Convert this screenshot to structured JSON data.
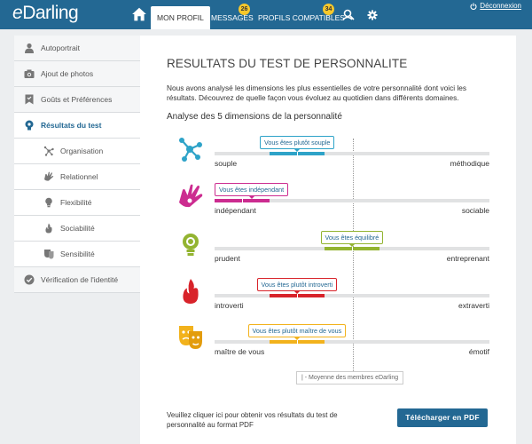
{
  "header": {
    "logo": "Darling",
    "logo_e": "e",
    "tabs": [
      {
        "label": "MON PROFIL"
      },
      {
        "label": "MESSAGES",
        "badge": "26"
      },
      {
        "label": "PROFILS COMPATIBLES",
        "badge": "34"
      }
    ],
    "logout": "Déconnexion"
  },
  "sidebar": {
    "items": [
      {
        "label": "Autoportrait",
        "icon": "person-icon"
      },
      {
        "label": "Ajout de photos",
        "icon": "camera-icon"
      },
      {
        "label": "Goûts et Préférences",
        "icon": "bookmark-icon"
      },
      {
        "label": "Résultats du test",
        "icon": "brain-icon",
        "active": true
      },
      {
        "label": "Organisation",
        "icon": "organisation-icon",
        "sub": true
      },
      {
        "label": "Relationnel",
        "icon": "hand-icon",
        "sub": true
      },
      {
        "label": "Flexibilité",
        "icon": "bulb-icon",
        "sub": true
      },
      {
        "label": "Sociabilité",
        "icon": "flame-icon",
        "sub": true
      },
      {
        "label": "Sensibilité",
        "icon": "mask-icon",
        "sub": true
      },
      {
        "label": "Vérification de l'identité",
        "icon": "shield-check-icon"
      }
    ]
  },
  "main": {
    "title": "RESULTATS DU TEST DE PERSONNALITE",
    "intro": "Nous avons analysé les dimensions les plus essentielles de votre personnalité dont voici les résultats. Découvrez de quelle façon vous évoluez au quotidien dans différents domaines.",
    "analysis_title": "Analyse des 5 dimensions de la personnalité",
    "dimensions": [
      {
        "left": "souple",
        "right": "méthodique",
        "tooltip": "Vous êtes plutôt souple",
        "color": "#2ea3c8",
        "range": [
          0.2,
          0.4
        ],
        "icon": "organisation-icon"
      },
      {
        "left": "indépendant",
        "right": "sociable",
        "tooltip": "Vous êtes indépendant",
        "color": "#cc2c90",
        "range": [
          0.0,
          0.2
        ],
        "icon": "hand-icon"
      },
      {
        "left": "prudent",
        "right": "entreprenant",
        "tooltip": "Vous êtes équilibré",
        "color": "#93b431",
        "range": [
          0.4,
          0.6
        ],
        "icon": "bulb-icon"
      },
      {
        "left": "introverti",
        "right": "extraverti",
        "tooltip": "Vous êtes plutôt introverti",
        "color": "#d8232a",
        "range": [
          0.2,
          0.4
        ],
        "icon": "flame-icon"
      },
      {
        "left": "maître de vous",
        "right": "émotif",
        "tooltip": "Vous êtes plutôt maître de vous",
        "color": "#f2b21c",
        "range": [
          0.2,
          0.4
        ],
        "icon": "mask-icon"
      }
    ],
    "average_legend": "| - Moyenne des membres eDarling",
    "pdf_text": "Veuillez cliquer ici pour obtenir vos résultats du test de personnalité au format PDF",
    "pdf_button": "Télécharger en PDF"
  }
}
